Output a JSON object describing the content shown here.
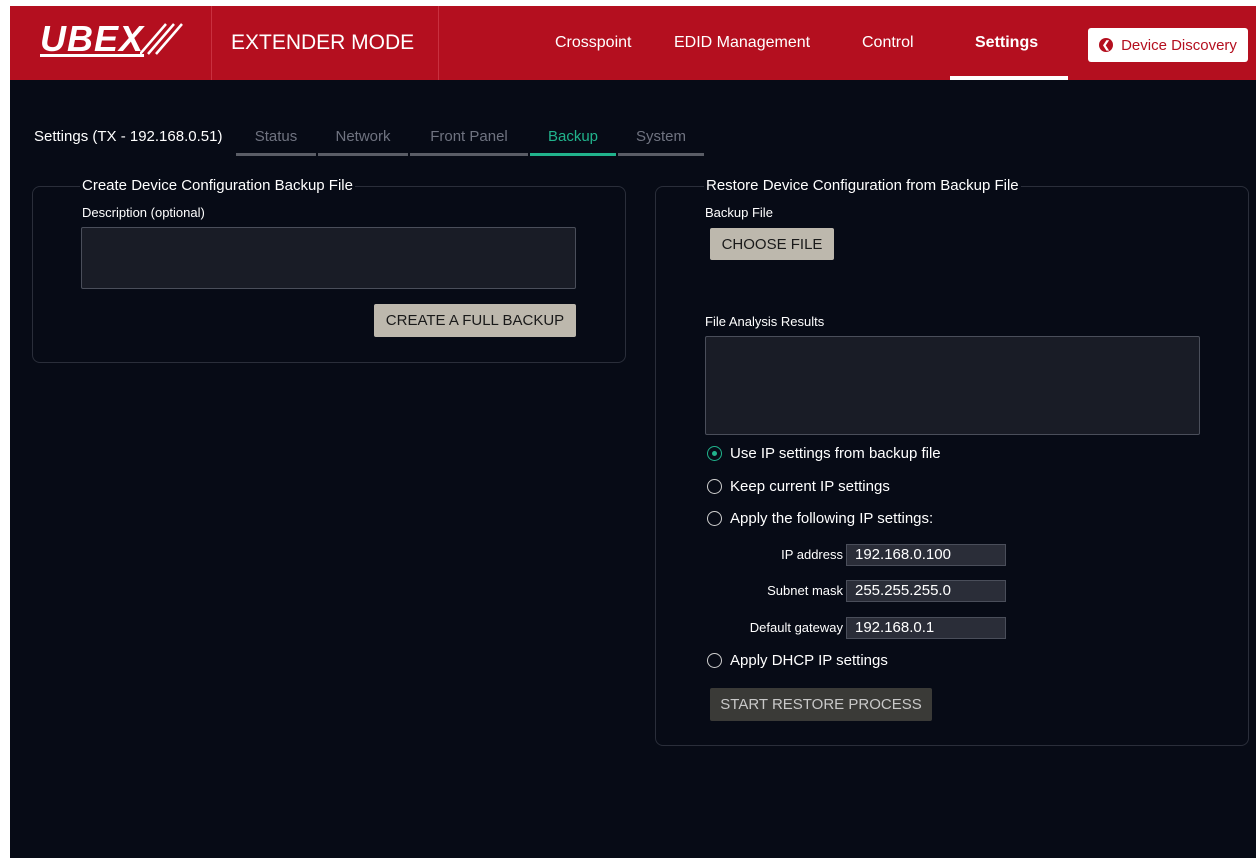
{
  "header": {
    "logo_text": "UBEX",
    "mode": "EXTENDER MODE",
    "nav": [
      "Crosspoint",
      "EDID Management",
      "Control",
      "Settings"
    ],
    "active_nav": "Settings",
    "discovery_label": "Device Discovery",
    "accent_color": "#b40f1f"
  },
  "settings_nav": {
    "title": "Settings (TX - 192.168.0.51)",
    "tabs": [
      "Status",
      "Network",
      "Front Panel",
      "Backup",
      "System"
    ],
    "active_tab": "Backup",
    "active_color": "#21b38c"
  },
  "backup_panel": {
    "legend": "Create Device Configuration Backup File",
    "description_label": "Description (optional)",
    "description_value": "",
    "create_button": "CREATE A FULL BACKUP"
  },
  "restore_panel": {
    "legend": "Restore Device Configuration from Backup File",
    "backup_file_label": "Backup File",
    "choose_button": "CHOOSE FILE",
    "analysis_label": "File Analysis Results",
    "analysis_value": "",
    "options": [
      {
        "label": "Use IP settings from backup file",
        "checked": true
      },
      {
        "label": "Keep current IP settings",
        "checked": false
      },
      {
        "label": "Apply the following IP settings:",
        "checked": false
      },
      {
        "label": "Apply DHCP IP settings",
        "checked": false
      }
    ],
    "ip_fields": {
      "ip_label": "IP address",
      "ip_value": "192.168.0.100",
      "mask_label": "Subnet mask",
      "mask_value": "255.255.255.0",
      "gw_label": "Default gateway",
      "gw_value": "192.168.0.1"
    },
    "start_button": "START RESTORE PROCESS"
  }
}
